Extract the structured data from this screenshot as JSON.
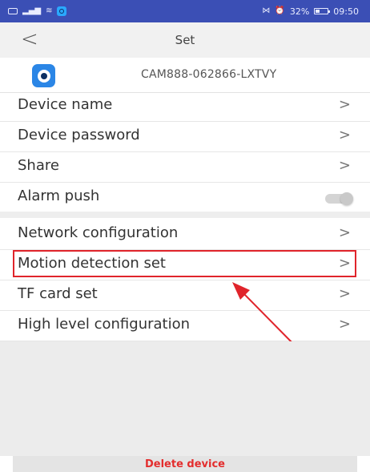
{
  "status_bar": {
    "battery": "32%",
    "time": "09:50",
    "left_icons": [
      "sim-icon",
      "signal-icon",
      "wifi-icon",
      "app-notification-icon"
    ],
    "right_icons": [
      "vibrate-icon",
      "alarm-icon",
      "battery-icon"
    ]
  },
  "header": {
    "title": "Set",
    "back_label": "<"
  },
  "device": {
    "id": "CAM888-062866-LXTVY",
    "logo_color": "#2b86e6"
  },
  "menu": {
    "group1": [
      {
        "label": "Device name",
        "chevron": ">"
      },
      {
        "label": "Device password",
        "chevron": ">"
      },
      {
        "label": "Share",
        "chevron": ">"
      },
      {
        "label": "Alarm push",
        "toggle": false
      }
    ],
    "group2": [
      {
        "label": "Network configuration",
        "chevron": ">"
      },
      {
        "label": "Motion detection set",
        "chevron": ">",
        "highlighted": true
      },
      {
        "label": "TF card set",
        "chevron": ">"
      },
      {
        "label": "High level configuration",
        "chevron": ">"
      }
    ]
  },
  "annotation": {
    "color": "#e0242b"
  },
  "footer": {
    "delete_label": "Delete device",
    "delete_color": "#e32d2d"
  }
}
